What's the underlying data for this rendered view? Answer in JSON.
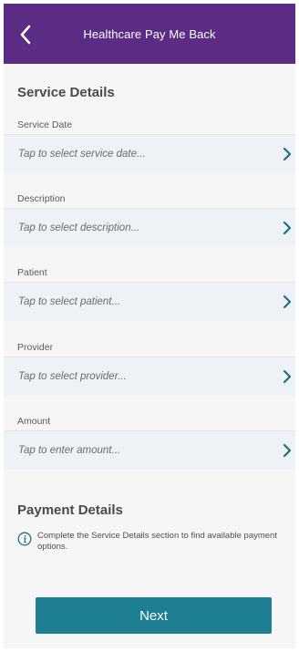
{
  "header": {
    "title": "Healthcare Pay Me Back",
    "back_icon": "chevron-left-icon",
    "background": "#5b2c83"
  },
  "service": {
    "title": "Service Details",
    "fields": [
      {
        "label": "Service Date",
        "placeholder": "Tap to select service date..."
      },
      {
        "label": "Description",
        "placeholder": "Tap to select description..."
      },
      {
        "label": "Patient",
        "placeholder": "Tap to select patient..."
      },
      {
        "label": "Provider",
        "placeholder": "Tap to select provider..."
      },
      {
        "label": "Amount",
        "placeholder": "Tap to enter amount..."
      }
    ],
    "row_icon": "chevron-right-icon"
  },
  "payment": {
    "title": "Payment Details",
    "info_icon": "info-icon",
    "info_text": "Complete the Service Details section to find available payment options."
  },
  "actions": {
    "next_label": "Next",
    "next_color": "#1f7f92"
  }
}
